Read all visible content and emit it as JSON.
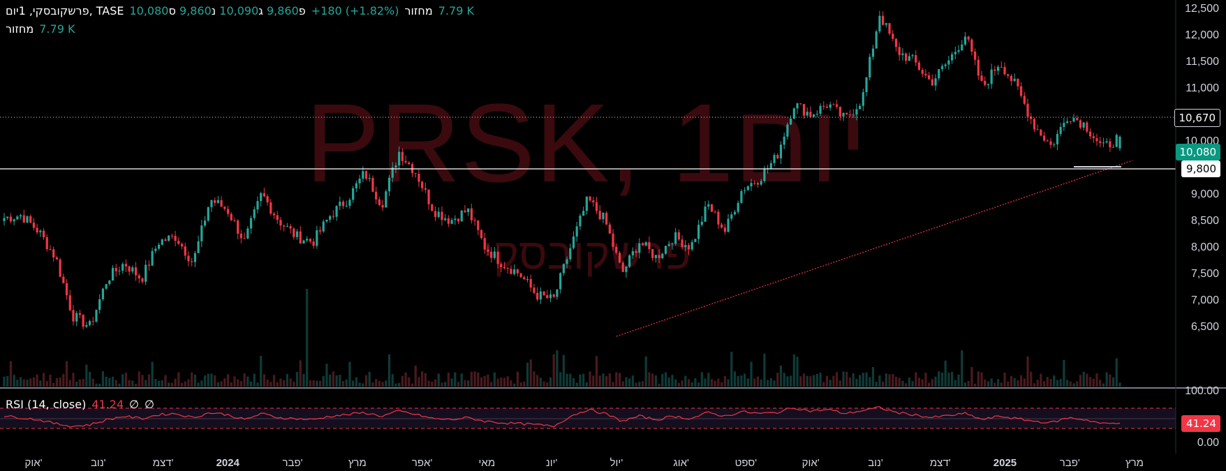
{
  "legend": {
    "title": "פרשקובסקי, 1יום, TASE",
    "o_label": "פ",
    "o_val": "9,860",
    "h_label": "ג",
    "h_val": "10,090",
    "l_label": "נ",
    "l_val": "9,860",
    "c_label": "ס",
    "c_val": "10,080",
    "change": "+180 (+1.82%)",
    "vol_label": "מחזור",
    "vol_val": "7.79 K"
  },
  "volume_legend": {
    "label": "מחזור",
    "value": "7.79 K"
  },
  "watermark": {
    "symbol": "PRSK, 1יום",
    "name": "פרשקובסקי"
  },
  "rsi": {
    "label": "RSI (14, close)",
    "value": "41.24",
    "na1": "∅",
    "na2": "∅"
  },
  "price_axis": {
    "ticks": [
      "12,500",
      "12,000",
      "11,500",
      "11,000",
      "10,500",
      "10,000",
      "9,500",
      "9,000",
      "8,500",
      "8,000",
      "7,500",
      "7,000",
      "6,500"
    ]
  },
  "rsi_axis": {
    "ticks": [
      "100.00",
      "0.00"
    ]
  },
  "price_labels": {
    "dotted_level": "10,670",
    "last_price": "10,080",
    "line_level": "9,800",
    "rsi_last": "41.24"
  },
  "time_axis": {
    "labels": [
      "אוק'",
      "נוב'",
      "דצמ'",
      "2024",
      "פבר'",
      "מרץ",
      "אפר'",
      "מאי",
      "יונ'",
      "יול'",
      "אוג'",
      "ספט'",
      "אוק'",
      "נוב'",
      "דצמ'",
      "2025",
      "פבר'",
      "מרץ"
    ]
  },
  "colors": {
    "up": "#26a69a",
    "down": "#f23645",
    "rsi_line": "#f23645",
    "background": "#000000",
    "trendline": "#f23645",
    "watermark": "#3a0a0e"
  },
  "chart_data": {
    "type": "candlestick",
    "symbol": "PRSK",
    "exchange": "TASE",
    "interval": "1D",
    "last": {
      "open": 9860,
      "high": 10090,
      "low": 9860,
      "close": 10080,
      "change": 180,
      "change_pct": 1.82,
      "volume": "7.79K"
    },
    "ylim": [
      6200,
      12600
    ],
    "horizontal_levels": [
      10670,
      9800
    ],
    "trendline": {
      "from": {
        "date": "2024-07",
        "price": 7000
      },
      "to": {
        "date": "2025-03",
        "price": 9880
      }
    },
    "approx_path": [
      {
        "date": "2023-09",
        "close": 8550
      },
      {
        "date": "2023-10",
        "close": 8600
      },
      {
        "date": "2023-10",
        "close": 8300
      },
      {
        "date": "2023-10",
        "close": 7800
      },
      {
        "date": "2023-10",
        "close": 6700
      },
      {
        "date": "2023-11",
        "close": 6500
      },
      {
        "date": "2023-11",
        "close": 7400
      },
      {
        "date": "2023-11",
        "close": 7700
      },
      {
        "date": "2023-11",
        "close": 7400
      },
      {
        "date": "2023-12",
        "close": 8100
      },
      {
        "date": "2023-12",
        "close": 8200
      },
      {
        "date": "2023-12",
        "close": 7700
      },
      {
        "date": "2023-12",
        "close": 8900
      },
      {
        "date": "2023-12",
        "close": 8700
      },
      {
        "date": "2024-01",
        "close": 8100
      },
      {
        "date": "2024-01",
        "close": 9000
      },
      {
        "date": "2024-01",
        "close": 8500
      },
      {
        "date": "2024-02",
        "close": 8200
      },
      {
        "date": "2024-02",
        "close": 8100
      },
      {
        "date": "2024-02",
        "close": 8600
      },
      {
        "date": "2024-03",
        "close": 8900
      },
      {
        "date": "2024-03",
        "close": 9400
      },
      {
        "date": "2024-03",
        "close": 8800
      },
      {
        "date": "2024-04",
        "close": 9800
      },
      {
        "date": "2024-04",
        "close": 9400
      },
      {
        "date": "2024-04",
        "close": 8700
      },
      {
        "date": "2024-05",
        "close": 8500
      },
      {
        "date": "2024-05",
        "close": 8700
      },
      {
        "date": "2024-06",
        "close": 8000
      },
      {
        "date": "2024-06",
        "close": 7700
      },
      {
        "date": "2024-06",
        "close": 7500
      },
      {
        "date": "2024-07",
        "close": 7100
      },
      {
        "date": "2024-07",
        "close": 7000
      },
      {
        "date": "2024-07",
        "close": 8000
      },
      {
        "date": "2024-07",
        "close": 8900
      },
      {
        "date": "2024-08",
        "close": 8500
      },
      {
        "date": "2024-08",
        "close": 7500
      },
      {
        "date": "2024-08",
        "close": 8100
      },
      {
        "date": "2024-09",
        "close": 7800
      },
      {
        "date": "2024-09",
        "close": 8200
      },
      {
        "date": "2024-09",
        "close": 8000
      },
      {
        "date": "2024-10",
        "close": 8800
      },
      {
        "date": "2024-10",
        "close": 8300
      },
      {
        "date": "2024-10",
        "close": 9100
      },
      {
        "date": "2024-11",
        "close": 9300
      },
      {
        "date": "2024-11",
        "close": 9700
      },
      {
        "date": "2024-11",
        "close": 10700
      },
      {
        "date": "2024-11",
        "close": 10500
      },
      {
        "date": "2024-12",
        "close": 10700
      },
      {
        "date": "2024-12",
        "close": 10400
      },
      {
        "date": "2024-12",
        "close": 10800
      },
      {
        "date": "2024-12",
        "close": 12400
      },
      {
        "date": "2024-12",
        "close": 11700
      },
      {
        "date": "2025-01",
        "close": 11500
      },
      {
        "date": "2025-01",
        "close": 11100
      },
      {
        "date": "2025-01",
        "close": 11500
      },
      {
        "date": "2025-01",
        "close": 12000
      },
      {
        "date": "2025-01",
        "close": 11000
      },
      {
        "date": "2025-02",
        "close": 11500
      },
      {
        "date": "2025-02",
        "close": 11000
      },
      {
        "date": "2025-02",
        "close": 10300
      },
      {
        "date": "2025-02",
        "close": 9900
      },
      {
        "date": "2025-02",
        "close": 10500
      },
      {
        "date": "2025-03",
        "close": 10300
      },
      {
        "date": "2025-03",
        "close": 9860
      },
      {
        "date": "2025-03",
        "close": 10080
      }
    ],
    "rsi_path": [
      55,
      52,
      48,
      40,
      35,
      38,
      48,
      55,
      50,
      58,
      60,
      52,
      62,
      58,
      48,
      60,
      52,
      50,
      48,
      55,
      58,
      62,
      55,
      65,
      58,
      50,
      48,
      52,
      45,
      42,
      40,
      38,
      35,
      55,
      68,
      60,
      45,
      55,
      48,
      55,
      50,
      62,
      55,
      64,
      60,
      62,
      72,
      65,
      68,
      60,
      66,
      72,
      62,
      58,
      52,
      56,
      60,
      48,
      55,
      50,
      45,
      42,
      52,
      48,
      40,
      41
    ],
    "volume_spikes": [
      {
        "date": "2024-03",
        "volume": "high"
      },
      {
        "date": "2024-07",
        "volume": "high"
      },
      {
        "date": "2024-11",
        "volume": "high"
      }
    ]
  }
}
